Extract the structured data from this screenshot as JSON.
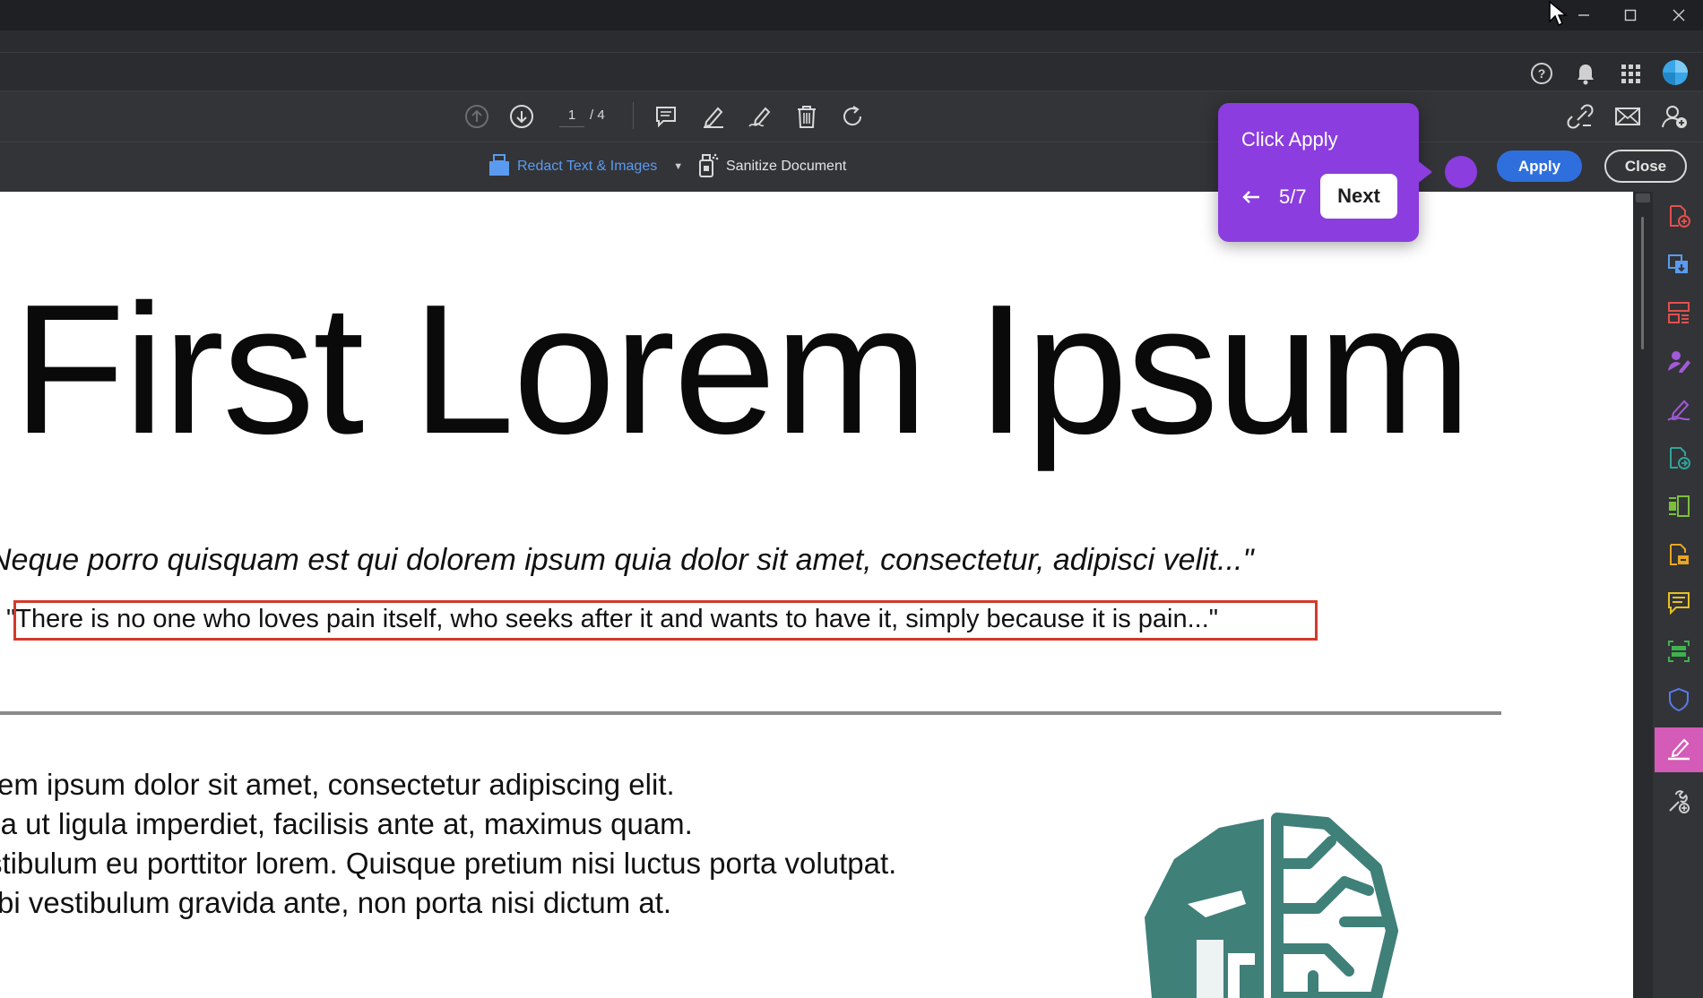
{
  "toolbar": {
    "page_current": "1",
    "page_total": "/ 4"
  },
  "redact": {
    "tool_label": "Redact Text & Images",
    "sanitize_label": "Sanitize Document",
    "apply_label": "Apply",
    "close_label": "Close"
  },
  "tour": {
    "title": "Click Apply",
    "step": "5/7",
    "next_label": "Next"
  },
  "document": {
    "title": "First Lorem Ipsum",
    "quote": "Neque porro quisquam est qui dolorem ipsum quia dolor sit amet, consectetur, adipisci velit...\"",
    "translation": "\"There is no one who loves pain itself, who seeks after it and wants to have it, simply because it is pain...\"",
    "body_lines": [
      "rem ipsum dolor sit amet, consectetur adipiscing elit.",
      "lla ut ligula imperdiet, facilisis ante at, maximus quam.",
      "stibulum eu porttitor lorem. Quisque pretium nisi luctus porta volutpat.",
      "rbi vestibulum gravida ante, non porta nisi dictum at."
    ]
  },
  "icons": {
    "window": [
      "minimize-icon",
      "maximize-icon",
      "close-icon"
    ],
    "header": [
      "help-icon",
      "bell-icon",
      "apps-grid-icon",
      "account-avatar-icon"
    ],
    "toolbar": [
      "page-up-icon",
      "page-down-icon",
      "comment-icon",
      "highlight-icon",
      "sign-icon",
      "delete-icon",
      "rotate-icon",
      "link-icon",
      "email-icon",
      "share-user-icon"
    ],
    "rail": [
      "create-pdf-icon",
      "export-pdf-icon",
      "organize-pages-icon",
      "request-signature-icon",
      "fill-sign-icon",
      "compress-icon",
      "edit-pdf-icon",
      "export-icon",
      "comment-icon",
      "scan-icon",
      "protect-icon",
      "redact-icon",
      "more-tools-icon"
    ]
  },
  "colors": {
    "accent_blue": "#2f6fdd",
    "tour_purple": "#8b3ddf",
    "redact_red": "#d23a2c",
    "rail_active": "#d45bb7",
    "logo_teal": "#3f8079"
  }
}
